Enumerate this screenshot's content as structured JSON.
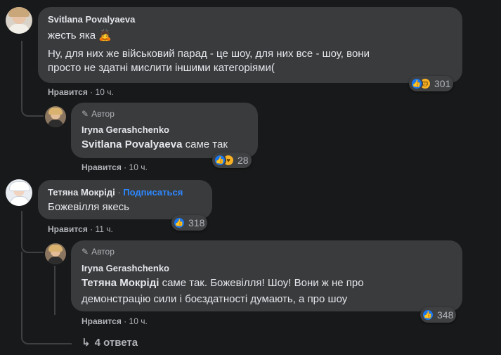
{
  "colors": {
    "background": "#18191a",
    "bubble": "#3a3b3c",
    "text": "#e4e6eb",
    "secondary": "#b0b3b8",
    "link": "#2d88ff",
    "like": "#1877f2"
  },
  "comments": [
    {
      "author": "Svitlana Povalyaeva",
      "line1": "жесть яка 🙇",
      "line2": "Ну, для них же військовий парад - це шоу, для них все - шоу, вони",
      "line3": "просто не здатні мислити іншими категоріями(",
      "like_label": "Нравится",
      "time": "10 ч.",
      "reaction_count": "301",
      "reactions": [
        "like-icon",
        "sad-icon"
      ]
    },
    {
      "badge": "Автор",
      "author": "Iryna Gerashchenko",
      "mention": "Svitlana Povalyaeva",
      "text": " саме так",
      "like_label": "Нравится",
      "time": "10 ч.",
      "reaction_count": "28",
      "reactions": [
        "like-icon",
        "care-icon"
      ]
    },
    {
      "author": "Тетяна Мокріді",
      "follow": "Подписаться",
      "text": "Божевілля якесь",
      "like_label": "Нравится",
      "time": "11 ч.",
      "reaction_count": "318",
      "reactions": [
        "like-icon"
      ]
    },
    {
      "badge": "Автор",
      "author": "Iryna Gerashchenko",
      "mention": "Тетяна Мокріді",
      "text1": " саме так. Божевілля! Шоу! Вони ж не про",
      "text2": "демонстрацію сили і боєздатності думають, а про шоу",
      "like_label": "Нравится",
      "time": "10 ч.",
      "reaction_count": "348",
      "reactions": [
        "like-icon"
      ]
    }
  ],
  "replies_link": "4 ответа",
  "separator": "·"
}
